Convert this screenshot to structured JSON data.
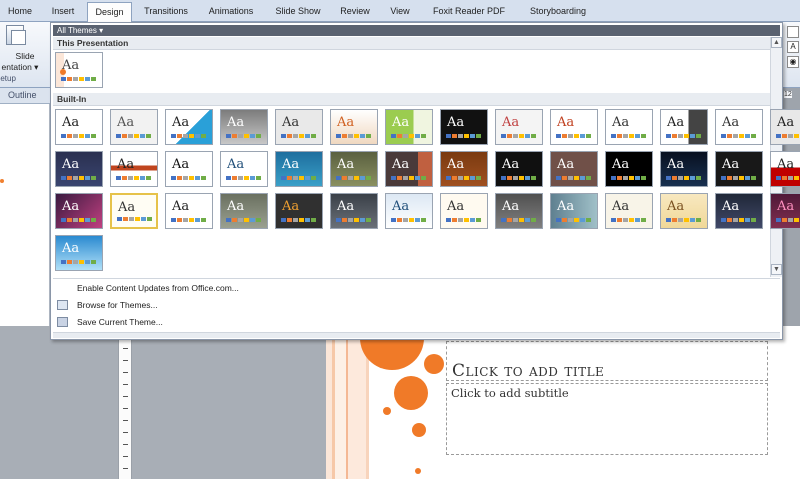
{
  "ribbon_tabs": [
    {
      "label": "Home"
    },
    {
      "label": "Insert"
    },
    {
      "label": "Design"
    },
    {
      "label": "Transitions"
    },
    {
      "label": "Animations"
    },
    {
      "label": "Slide Show"
    },
    {
      "label": "Review"
    },
    {
      "label": "View"
    },
    {
      "label": "Foxit Reader PDF"
    },
    {
      "label": "Storyboarding"
    }
  ],
  "active_tab": "Design",
  "ribbon": {
    "slide_setup_line1": "Slide",
    "slide_setup_line2": "entation",
    "setup_group": "Setup"
  },
  "left_pane": {
    "outline_tab": "Outline"
  },
  "ruler": {
    "top_number": "12"
  },
  "themes_gallery": {
    "header": "All Themes ▾",
    "this_presentation_label": "This Presentation",
    "builtin_label": "Built-In",
    "theme_sample_text": "Aa",
    "menu": [
      {
        "label": "Enable Content Updates from Office.com...",
        "icon": "none"
      },
      {
        "label": "Browse for Themes...",
        "icon": "folder-icon"
      },
      {
        "label": "Save Current Theme...",
        "icon": "save-icon"
      }
    ]
  },
  "slide": {
    "title_placeholder": "Click to add title",
    "subtitle_placeholder": "Click to add subtitle"
  },
  "colors": {
    "accent_orange": "#f07a28",
    "gallery_header_bg": "#5a6270",
    "selected_border": "#e6c24a"
  }
}
